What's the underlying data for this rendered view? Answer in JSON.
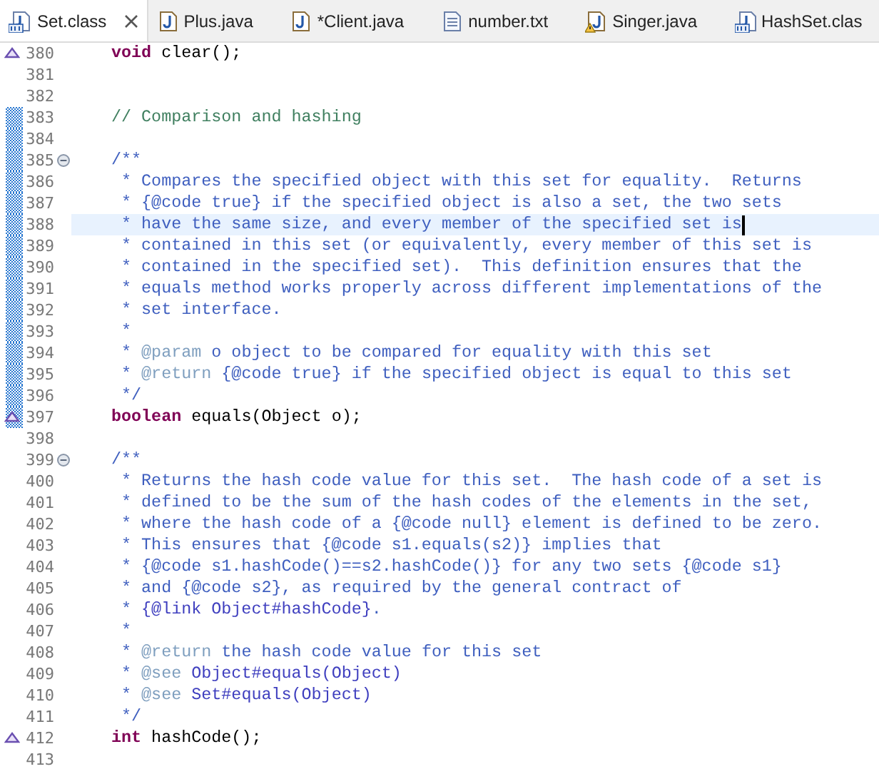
{
  "tabs": [
    {
      "label": "Set.class",
      "kind": "class",
      "selected": true,
      "closable": true
    },
    {
      "label": "Plus.java",
      "kind": "java",
      "selected": false,
      "closable": false
    },
    {
      "label": "*Client.java",
      "kind": "java",
      "selected": false,
      "closable": false
    },
    {
      "label": "number.txt",
      "kind": "text",
      "selected": false,
      "closable": false
    },
    {
      "label": "Singer.java",
      "kind": "java-warning",
      "selected": false,
      "closable": false
    },
    {
      "label": "HashSet.clas",
      "kind": "class",
      "selected": false,
      "closable": false
    }
  ],
  "editor": {
    "lines": [
      {
        "number": "380",
        "changed": false,
        "current": false,
        "override": true,
        "foldable": false,
        "tokens": [
          {
            "t": "void",
            "kind": "keyword"
          },
          {
            "t": " clear();",
            "kind": "code"
          }
        ]
      },
      {
        "number": "381",
        "changed": false,
        "current": false,
        "override": false,
        "foldable": false
      },
      {
        "number": "382",
        "changed": false,
        "current": false,
        "override": false,
        "foldable": false
      },
      {
        "number": "383",
        "changed": true,
        "current": false,
        "override": false,
        "foldable": false,
        "tokens": [
          {
            "t": "// Comparison and hashing",
            "kind": "comment"
          }
        ]
      },
      {
        "number": "384",
        "changed": true,
        "current": false,
        "override": false,
        "foldable": false
      },
      {
        "number": "385",
        "changed": true,
        "current": false,
        "override": false,
        "foldable": true,
        "tokens": [
          {
            "t": "/**",
            "kind": "doc"
          }
        ]
      },
      {
        "number": "386",
        "changed": true,
        "current": false,
        "override": false,
        "foldable": false,
        "tokens": [
          {
            "t": " * Compares the specified object with this set for equality.  Returns",
            "kind": "doc"
          }
        ]
      },
      {
        "number": "387",
        "changed": true,
        "current": false,
        "override": false,
        "foldable": false,
        "tokens": [
          {
            "t": " * {@code true} if the specified object is also a set, the two sets",
            "kind": "doc"
          }
        ]
      },
      {
        "number": "388",
        "changed": true,
        "current": true,
        "override": false,
        "foldable": false,
        "tokens": [
          {
            "t": " * have the same size, and every member of the specified set is",
            "kind": "doc"
          }
        ]
      },
      {
        "number": "389",
        "changed": true,
        "current": false,
        "override": false,
        "foldable": false,
        "tokens": [
          {
            "t": " * contained in this set (or equivalently, every member of this set is",
            "kind": "doc"
          }
        ]
      },
      {
        "number": "390",
        "changed": true,
        "current": false,
        "override": false,
        "foldable": false,
        "tokens": [
          {
            "t": " * contained in the specified set).  This definition ensures that the",
            "kind": "doc"
          }
        ]
      },
      {
        "number": "391",
        "changed": true,
        "current": false,
        "override": false,
        "foldable": false,
        "tokens": [
          {
            "t": " * equals method works properly across different implementations of the",
            "kind": "doc"
          }
        ]
      },
      {
        "number": "392",
        "changed": true,
        "current": false,
        "override": false,
        "foldable": false,
        "tokens": [
          {
            "t": " * set interface.",
            "kind": "doc"
          }
        ]
      },
      {
        "number": "393",
        "changed": true,
        "current": false,
        "override": false,
        "foldable": false,
        "tokens": [
          {
            "t": " *",
            "kind": "doc"
          }
        ]
      },
      {
        "number": "394",
        "changed": true,
        "current": false,
        "override": false,
        "foldable": false,
        "tokens": [
          {
            "t": " * ",
            "kind": "doc"
          },
          {
            "t": "@param",
            "kind": "doc-tag"
          },
          {
            "t": " o object to be compared for equality with this set",
            "kind": "doc"
          }
        ]
      },
      {
        "number": "395",
        "changed": true,
        "current": false,
        "override": false,
        "foldable": false,
        "tokens": [
          {
            "t": " * ",
            "kind": "doc"
          },
          {
            "t": "@return",
            "kind": "doc-tag"
          },
          {
            "t": " {@code true} if the specified object is equal to this set",
            "kind": "doc"
          }
        ]
      },
      {
        "number": "396",
        "changed": true,
        "current": false,
        "override": false,
        "foldable": false,
        "tokens": [
          {
            "t": " */",
            "kind": "doc"
          }
        ]
      },
      {
        "number": "397",
        "changed": true,
        "current": false,
        "override": true,
        "foldable": false,
        "tokens": [
          {
            "t": "boolean",
            "kind": "keyword"
          },
          {
            "t": " equals(Object o);",
            "kind": "code"
          }
        ]
      },
      {
        "number": "398",
        "changed": false,
        "current": false,
        "override": false,
        "foldable": false
      },
      {
        "number": "399",
        "changed": false,
        "current": false,
        "override": false,
        "foldable": true,
        "tokens": [
          {
            "t": "/**",
            "kind": "doc"
          }
        ]
      },
      {
        "number": "400",
        "changed": false,
        "current": false,
        "override": false,
        "foldable": false,
        "tokens": [
          {
            "t": " * Returns the hash code value for this set.  The hash code of a set is",
            "kind": "doc"
          }
        ]
      },
      {
        "number": "401",
        "changed": false,
        "current": false,
        "override": false,
        "foldable": false,
        "tokens": [
          {
            "t": " * defined to be the sum of the hash codes of the elements in the set,",
            "kind": "doc"
          }
        ]
      },
      {
        "number": "402",
        "changed": false,
        "current": false,
        "override": false,
        "foldable": false,
        "tokens": [
          {
            "t": " * where the hash code of a {@code null} element is defined to be zero.",
            "kind": "doc"
          }
        ]
      },
      {
        "number": "403",
        "changed": false,
        "current": false,
        "override": false,
        "foldable": false,
        "tokens": [
          {
            "t": " * This ensures that {@code s1.equals(s2)} implies that",
            "kind": "doc"
          }
        ]
      },
      {
        "number": "404",
        "changed": false,
        "current": false,
        "override": false,
        "foldable": false,
        "tokens": [
          {
            "t": " * {@code s1.hashCode()==s2.hashCode()} for any two sets {@code s1}",
            "kind": "doc"
          }
        ]
      },
      {
        "number": "405",
        "changed": false,
        "current": false,
        "override": false,
        "foldable": false,
        "tokens": [
          {
            "t": " * and {@code s2}, as required by the general contract of",
            "kind": "doc"
          }
        ]
      },
      {
        "number": "406",
        "changed": false,
        "current": false,
        "override": false,
        "foldable": false,
        "tokens": [
          {
            "t": " * ",
            "kind": "doc"
          },
          {
            "t": "{@link Object#hashCode}",
            "kind": "doc-link"
          },
          {
            "t": ".",
            "kind": "doc"
          }
        ]
      },
      {
        "number": "407",
        "changed": false,
        "current": false,
        "override": false,
        "foldable": false,
        "tokens": [
          {
            "t": " *",
            "kind": "doc"
          }
        ]
      },
      {
        "number": "408",
        "changed": false,
        "current": false,
        "override": false,
        "foldable": false,
        "tokens": [
          {
            "t": " * ",
            "kind": "doc"
          },
          {
            "t": "@return",
            "kind": "doc-tag"
          },
          {
            "t": " the hash code value for this set",
            "kind": "doc"
          }
        ]
      },
      {
        "number": "409",
        "changed": false,
        "current": false,
        "override": false,
        "foldable": false,
        "tokens": [
          {
            "t": " * ",
            "kind": "doc"
          },
          {
            "t": "@see",
            "kind": "doc-tag"
          },
          {
            "t": " Object#equals(Object)",
            "kind": "doc-link"
          }
        ]
      },
      {
        "number": "410",
        "changed": false,
        "current": false,
        "override": false,
        "foldable": false,
        "tokens": [
          {
            "t": " * ",
            "kind": "doc"
          },
          {
            "t": "@see",
            "kind": "doc-tag"
          },
          {
            "t": " Set#equals(Object)",
            "kind": "doc-link"
          }
        ]
      },
      {
        "number": "411",
        "changed": false,
        "current": false,
        "override": false,
        "foldable": false,
        "tokens": [
          {
            "t": " */",
            "kind": "doc"
          }
        ]
      },
      {
        "number": "412",
        "changed": false,
        "current": false,
        "override": true,
        "foldable": false,
        "tokens": [
          {
            "t": "int",
            "kind": "keyword"
          },
          {
            "t": " hashCode();",
            "kind": "code"
          }
        ]
      },
      {
        "number": "413",
        "changed": false,
        "current": false,
        "override": false,
        "foldable": false
      }
    ]
  }
}
